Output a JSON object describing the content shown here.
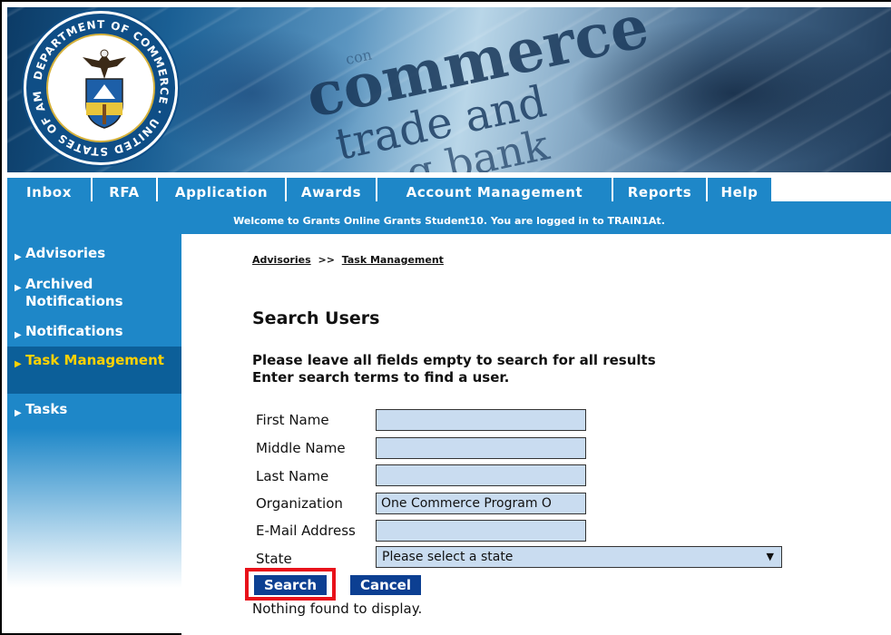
{
  "banner": {
    "seal_text": "DEPARTMENT OF COMMERCE · UNITED STATES OF AMERICA",
    "words": [
      "con",
      "commerce",
      "trade and",
      "g bank"
    ]
  },
  "nav": {
    "tabs": [
      "Inbox",
      "RFA",
      "Application",
      "Awards",
      "Account Management",
      "Reports",
      "Help"
    ]
  },
  "welcome": "Welcome to Grants Online Grants Student10. You are logged in to TRAIN1At.",
  "sidebar": {
    "items": [
      {
        "label": "Advisories"
      },
      {
        "label": "Archived Notifications"
      },
      {
        "label": "Notifications"
      },
      {
        "label": "Task Management",
        "active": true
      },
      {
        "label": "Tasks"
      }
    ]
  },
  "breadcrumb": {
    "items": [
      "Advisories",
      "Task Management"
    ],
    "separator": ">>"
  },
  "page_title": "Search Users",
  "instructions": {
    "line1": "Please leave all fields empty to search for all results",
    "line2": "Enter search terms to find a user."
  },
  "form": {
    "fields": [
      {
        "label": "First Name",
        "value": ""
      },
      {
        "label": "Middle Name",
        "value": ""
      },
      {
        "label": "Last Name",
        "value": ""
      },
      {
        "label": "Organization",
        "value": "One Commerce Program O"
      },
      {
        "label": "E-Mail Address",
        "value": ""
      }
    ],
    "state_label": "State",
    "state_value": "Please select a state"
  },
  "buttons": {
    "search": "Search",
    "cancel": "Cancel"
  },
  "result_text": "Nothing found to display.",
  "colors": {
    "nav_blue": "#1e87c8",
    "button_blue": "#0c3f92",
    "field_fill": "#c9dcf0",
    "highlight_red": "#e8111a",
    "active_text": "#ffd200"
  }
}
